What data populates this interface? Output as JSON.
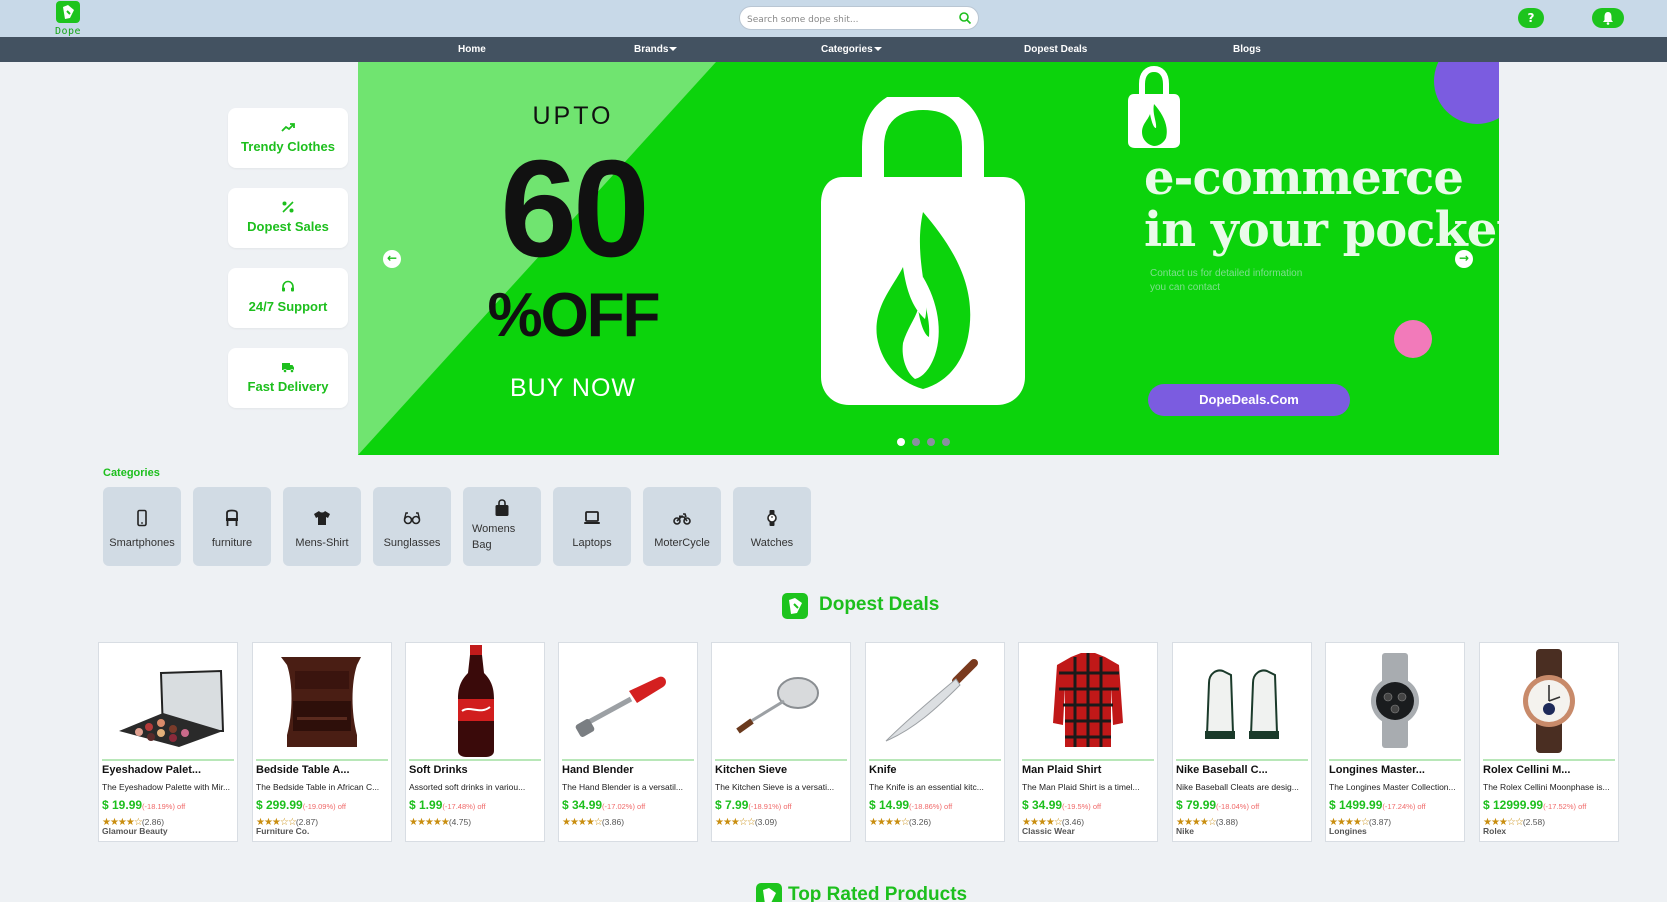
{
  "app": {
    "logo_text": "Dope Deals"
  },
  "search": {
    "placeholder": "Search some dope shit..."
  },
  "header": {
    "help_label": "?"
  },
  "nav": {
    "items": [
      {
        "label": "Home"
      },
      {
        "label": "Brands"
      },
      {
        "label": "Categories"
      },
      {
        "label": "Dopest Deals"
      },
      {
        "label": "Blogs"
      }
    ]
  },
  "features": [
    {
      "label": "Trendy Clothes",
      "icon": "trending-up-icon"
    },
    {
      "label": "Dopest Sales",
      "icon": "percent-icon"
    },
    {
      "label": "24/7 Support",
      "icon": "headset-icon"
    },
    {
      "label": "Fast Delivery",
      "icon": "truck-icon"
    }
  ],
  "banner": {
    "upto": "UPTO",
    "percent": "60",
    "off": "%OFF",
    "buy_now": "BUY NOW",
    "headline_1": "e-commerce",
    "headline_2": "in your pocket",
    "subtext_1": "Contact us for detailed information",
    "subtext_2": "you can contact",
    "cta": "DopeDeals.Com",
    "prev_arrow": "←",
    "next_arrow": "→",
    "slide_count": 4,
    "active_slide": 1,
    "colors": {
      "background": "#0cd30c",
      "accent_purple": "#7b5ce0",
      "accent_pink": "#f27aba"
    }
  },
  "categories": {
    "title": "Categories",
    "items": [
      {
        "label": "Smartphones",
        "icon": "smartphone-icon"
      },
      {
        "label": "furniture",
        "icon": "chair-icon"
      },
      {
        "label": "Mens-Shirt",
        "icon": "shirt-icon"
      },
      {
        "label": "Sunglasses",
        "icon": "glasses-icon"
      },
      {
        "label": "Womens Bag",
        "icon": "bag-icon"
      },
      {
        "label": "Laptops",
        "icon": "laptop-icon"
      },
      {
        "label": "MoterCycle",
        "icon": "motorcycle-icon"
      },
      {
        "label": "Watches",
        "icon": "watch-icon"
      }
    ]
  },
  "deals": {
    "title": "Dopest Deals",
    "products": [
      {
        "name": "Eyeshadow Palet...",
        "desc": "The Eyeshadow Palette with Mir...",
        "price": "$ 19.99",
        "discount": "(-18.19%) off",
        "stars": "★★★★☆",
        "rating": "(2.86)",
        "brand": "Glamour Beauty"
      },
      {
        "name": "Bedside Table A...",
        "desc": "The Bedside Table in African C...",
        "price": "$ 299.99",
        "discount": "(-19.09%) off",
        "stars": "★★★☆☆",
        "rating": "(2.87)",
        "brand": "Furniture Co."
      },
      {
        "name": "Soft Drinks",
        "desc": "Assorted soft drinks in variou...",
        "price": "$ 1.99",
        "discount": "(-17.48%) off",
        "stars": "★★★★★",
        "rating": "(4.75)",
        "brand": ""
      },
      {
        "name": "Hand Blender",
        "desc": "The Hand Blender is a versatil...",
        "price": "$ 34.99",
        "discount": "(-17.02%) off",
        "stars": "★★★★☆",
        "rating": "(3.86)",
        "brand": ""
      },
      {
        "name": "Kitchen Sieve",
        "desc": "The Kitchen Sieve is a versati...",
        "price": "$ 7.99",
        "discount": "(-18.91%) off",
        "stars": "★★★☆☆",
        "rating": "(3.09)",
        "brand": ""
      },
      {
        "name": "Knife",
        "desc": "The Knife is an essential kitc...",
        "price": "$ 14.99",
        "discount": "(-18.86%) off",
        "stars": "★★★★☆",
        "rating": "(3.26)",
        "brand": ""
      },
      {
        "name": "Man Plaid Shirt",
        "desc": "The Man Plaid Shirt is a timel...",
        "price": "$ 34.99",
        "discount": "(-19.5%) off",
        "stars": "★★★★☆",
        "rating": "(3.46)",
        "brand": "Classic Wear"
      },
      {
        "name": "Nike Baseball C...",
        "desc": "Nike Baseball Cleats are desig...",
        "price": "$ 79.99",
        "discount": "(-18.04%) off",
        "stars": "★★★★☆",
        "rating": "(3.88)",
        "brand": "Nike"
      },
      {
        "name": "Longines Master...",
        "desc": "The Longines Master Collection...",
        "price": "$ 1499.99",
        "discount": "(-17.24%) off",
        "stars": "★★★★☆",
        "rating": "(3.87)",
        "brand": "Longines"
      },
      {
        "name": "Rolex Cellini M...",
        "desc": "The Rolex Cellini Moonphase is...",
        "price": "$ 12999.99",
        "discount": "(-17.52%) off",
        "stars": "★★★☆☆",
        "rating": "(2.58)",
        "brand": "Rolex"
      }
    ]
  },
  "top_rated": {
    "title": "Top Rated Products"
  }
}
